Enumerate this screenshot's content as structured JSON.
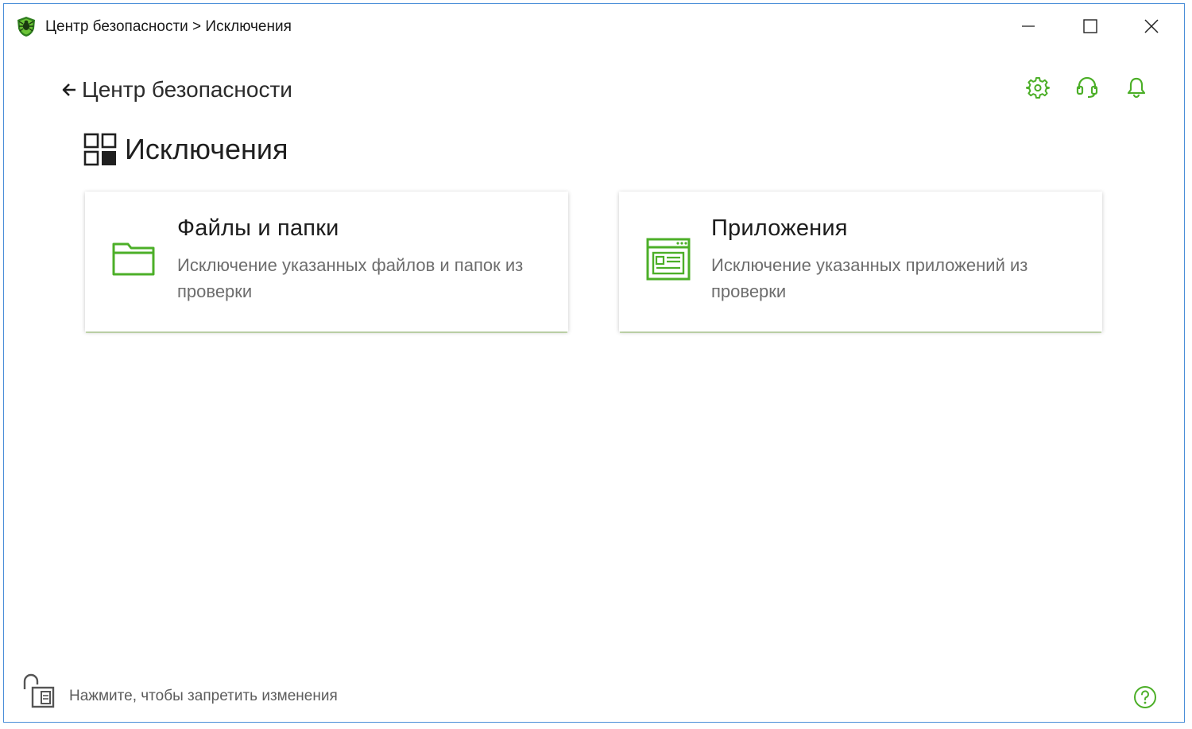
{
  "window": {
    "title": "Центр безопасности > Исключения",
    "icons": {
      "logo": "dr-web-spider-logo",
      "minimize": "minimize-icon",
      "maximize": "maximize-icon",
      "close": "close-icon"
    }
  },
  "header": {
    "back_label": "Центр безопасности",
    "toolbar_icons": [
      "gear-icon",
      "headset-icon",
      "bell-icon"
    ]
  },
  "page": {
    "title": "Исключения",
    "icon": "grid-icon"
  },
  "cards": [
    {
      "title": "Файлы и папки",
      "description": "Исключение указанных файлов и папок из проверки",
      "icon": "folder-icon"
    },
    {
      "title": "Приложения",
      "description": "Исключение указанных приложений из проверки",
      "icon": "application-window-icon"
    }
  ],
  "footer": {
    "lock_label": "Нажмите, чтобы запретить изменения",
    "lock_icon": "unlocked-padlock-icon",
    "help_icon": "help-icon"
  },
  "colors": {
    "accent": "#4caf28",
    "window_border": "#4a8ed8",
    "text": "#1f1f1f",
    "muted_text": "#6d6d6d"
  }
}
